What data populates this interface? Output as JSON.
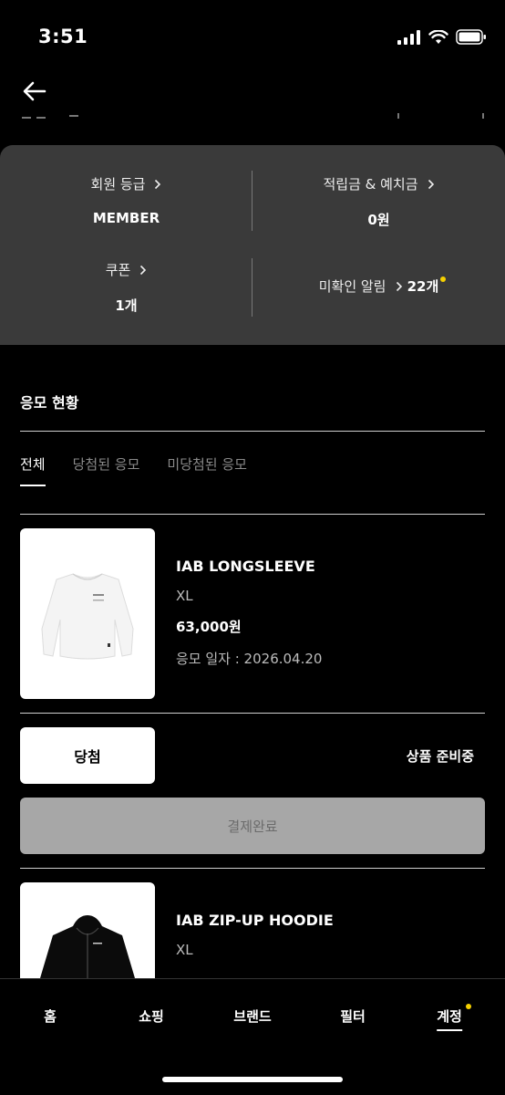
{
  "status": {
    "time": "3:51"
  },
  "member": {
    "grade_label": "회원 등급",
    "grade_value": "MEMBER",
    "points_label": "적립금 & 예치금",
    "points_value": "0원",
    "coupon_label": "쿠폰",
    "coupon_value": "1개",
    "alerts_label": "미확인 알림",
    "alerts_value": "22개"
  },
  "section": {
    "title": "응모 현황"
  },
  "tabs": [
    {
      "label": "전체",
      "active": true
    },
    {
      "label": "당첨된 응모",
      "active": false
    },
    {
      "label": "미당첨된 응모",
      "active": false
    }
  ],
  "entries": [
    {
      "name": "IAB LONGSLEEVE",
      "size": "XL",
      "price": "63,000원",
      "date": "응모 일자 : 2026.04.20",
      "result_label": "당첨",
      "ship_status": "상품 준비중",
      "pay_label": "결제완료"
    },
    {
      "name": "IAB ZIP-UP HOODIE",
      "size": "XL"
    }
  ],
  "nav": [
    {
      "label": "홈"
    },
    {
      "label": "쇼핑"
    },
    {
      "label": "브랜드"
    },
    {
      "label": "필터"
    },
    {
      "label": "계정"
    }
  ],
  "colors": {
    "accent_dot": "#f5d000",
    "card_bg": "#3a3a3a"
  }
}
